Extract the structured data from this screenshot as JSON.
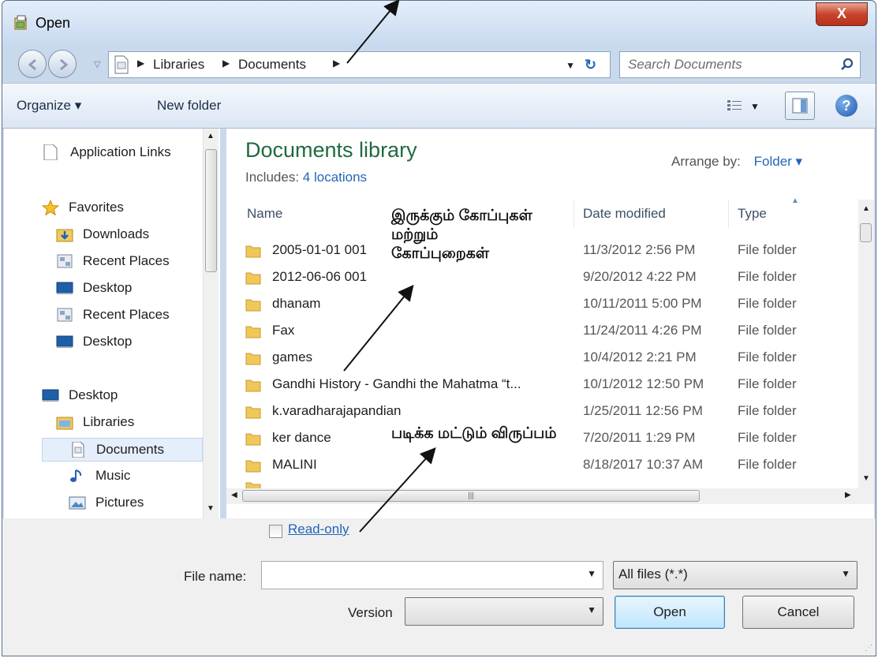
{
  "window": {
    "title": "Open",
    "close_label": "X"
  },
  "address": {
    "crumbs": [
      "Libraries",
      "Documents"
    ],
    "search_placeholder": "Search Documents"
  },
  "toolbar": {
    "organize": "Organize ▾",
    "new_folder": "New folder",
    "help": "?"
  },
  "nav": {
    "items": [
      {
        "label": "Application Links",
        "icon": "document-icon"
      },
      {
        "label": "Favorites",
        "icon": "star-icon"
      },
      {
        "label": "Downloads",
        "icon": "downloads-folder-icon"
      },
      {
        "label": "Recent Places",
        "icon": "recent-places-icon"
      },
      {
        "label": "Desktop",
        "icon": "desktop-icon"
      },
      {
        "label": "Recent Places",
        "icon": "recent-places-icon"
      },
      {
        "label": "Desktop",
        "icon": "desktop-icon"
      },
      {
        "label": "Desktop",
        "icon": "desktop-icon"
      },
      {
        "label": "Libraries",
        "icon": "libraries-icon"
      },
      {
        "label": "Documents",
        "icon": "documents-icon"
      },
      {
        "label": "Music",
        "icon": "music-icon"
      },
      {
        "label": "Pictures",
        "icon": "pictures-icon"
      }
    ]
  },
  "library": {
    "title": "Documents library",
    "includes_label": "Includes:",
    "includes_link": "4 locations",
    "arrange_label": "Arrange by:",
    "arrange_value": "Folder ▾"
  },
  "columns": {
    "name": "Name",
    "date": "Date modified",
    "type": "Type"
  },
  "files": [
    {
      "name": "2005-01-01 001",
      "date": "11/3/2012 2:56 PM",
      "type": "File folder"
    },
    {
      "name": "2012-06-06 001",
      "date": "9/20/2012 4:22 PM",
      "type": "File folder"
    },
    {
      "name": "dhanam",
      "date": "10/11/2011 5:00 PM",
      "type": "File folder"
    },
    {
      "name": "Fax",
      "date": "11/24/2011 4:26 PM",
      "type": "File folder"
    },
    {
      "name": "games",
      "date": "10/4/2012 2:21 PM",
      "type": "File folder"
    },
    {
      "name": "Gandhi History - Gandhi the Mahatma “t...",
      "date": "10/1/2012 12:50 PM",
      "type": "File folder"
    },
    {
      "name": "k.varadharajapandian",
      "date": "1/25/2011 12:56 PM",
      "type": "File folder"
    },
    {
      "name": "ker dance",
      "date": "7/20/2011 1:29 PM",
      "type": "File folder"
    },
    {
      "name": "MALINI",
      "date": "8/18/2017 10:37 AM",
      "type": "File folder"
    }
  ],
  "footer": {
    "readonly_label": "Read-only",
    "filename_label": "File name:",
    "filename_value": "",
    "filetype_value": "All files (*.*)",
    "version_label": "Version",
    "version_value": "",
    "open_label": "Open",
    "cancel_label": "Cancel"
  },
  "annotations": {
    "files_folders": [
      "இருக்கும் கோப்புகள்",
      "மற்றும்",
      "கோப்புறைகள்"
    ],
    "read_only": "படிக்க மட்டும் விருப்பம்"
  },
  "colors": {
    "library_title": "#1f6a3f",
    "link": "#2466b8",
    "window_frame": "#c9d9ec"
  }
}
